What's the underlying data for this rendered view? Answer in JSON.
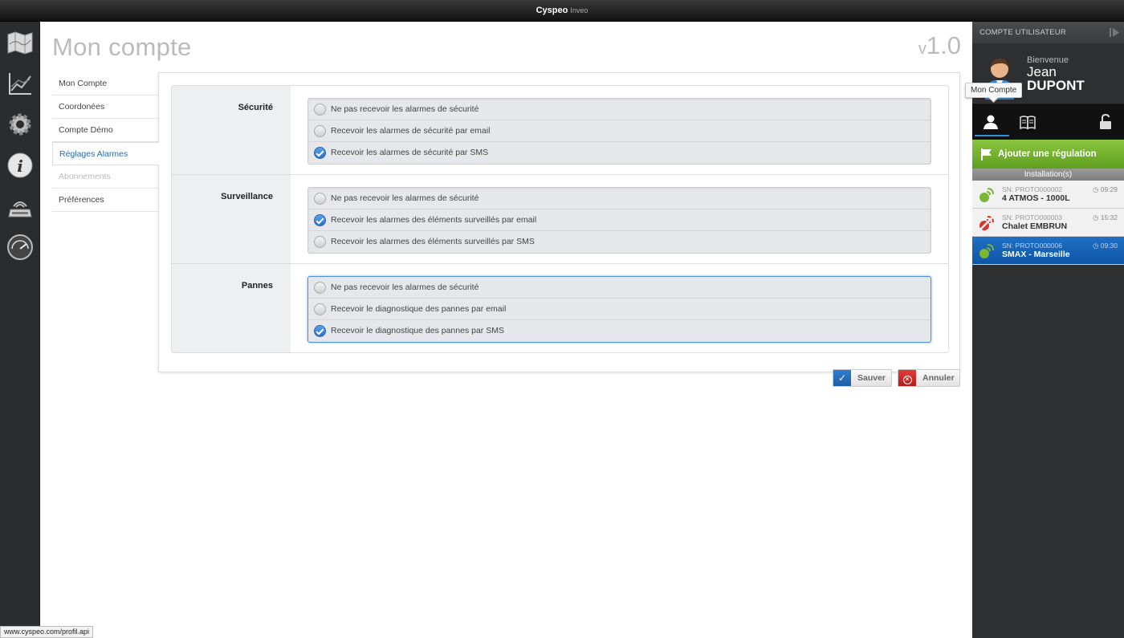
{
  "app": {
    "brand": "Cyspeo",
    "brand_sub": "Inveo"
  },
  "page": {
    "title": "Mon compte",
    "version_prefix": "v",
    "version": "1.0"
  },
  "subnav": [
    {
      "label": "Mon Compte"
    },
    {
      "label": "Coordonées"
    },
    {
      "label": "Compte Démo"
    },
    {
      "label": "Réglages Alarmes"
    },
    {
      "label": "Abonnements"
    },
    {
      "label": "Préférences"
    }
  ],
  "sections": [
    {
      "label": "Sécurité",
      "options": [
        {
          "label": "Ne pas recevoir les alarmes de sécurité",
          "checked": false
        },
        {
          "label": "Recevoir les alarmes de sécurité par email",
          "checked": false
        },
        {
          "label": "Recevoir les alarmes de sécurité par SMS",
          "checked": true
        }
      ]
    },
    {
      "label": "Surveillance",
      "options": [
        {
          "label": "Ne pas recevoir les alarmes de sécurité",
          "checked": false
        },
        {
          "label": "Recevoir les alarmes des éléments surveillés par email",
          "checked": true
        },
        {
          "label": "Recevoir les alarmes des éléments surveillés par SMS",
          "checked": false
        }
      ]
    },
    {
      "label": "Pannes",
      "options": [
        {
          "label": "Ne pas recevoir les alarmes de sécurité",
          "checked": false
        },
        {
          "label": "Recevoir le diagnostique des pannes par email",
          "checked": false
        },
        {
          "label": "Recevoir le diagnostique des pannes par SMS",
          "checked": true
        }
      ]
    }
  ],
  "actions": {
    "save": "Sauver",
    "cancel": "Annuler"
  },
  "statusbar": "www.cyspeo.com/profil.api",
  "sidebar": {
    "header": "COMPTE UTILISATEUR",
    "welcome": "Bienvenue",
    "first_name": "Jean",
    "last_name": "DUPONT",
    "tooltip": "Mon Compte",
    "add_button": "Ajouter une régulation",
    "installations_header": "Installation(s)",
    "installations": [
      {
        "sn": "SN: PROTO000002",
        "name": "4 ATMOS - 1000L",
        "time": "09:29",
        "status": "ok"
      },
      {
        "sn": "SN: PROTO000003",
        "name": "Chalet EMBRUN",
        "time": "15:32",
        "status": "off"
      },
      {
        "sn": "SN: PROTO000006",
        "name": "SMAX - Marseille",
        "time": "09:30",
        "status": "ok"
      }
    ]
  },
  "colors": {
    "accent": "#2a72c4",
    "add_green": "#7ab533",
    "cancel_red": "#d32f2f",
    "selected_blue": "#1661b5"
  }
}
